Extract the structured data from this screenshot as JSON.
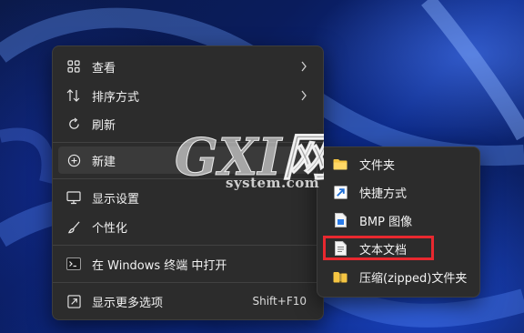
{
  "main_menu": {
    "items": [
      {
        "label": "查看",
        "icon": "grid-icon",
        "has_submenu": true
      },
      {
        "label": "排序方式",
        "icon": "sort-icon",
        "has_submenu": true
      },
      {
        "label": "刷新",
        "icon": "refresh-icon"
      },
      {
        "label": "新建",
        "icon": "plus-circle-icon",
        "has_submenu": true
      },
      {
        "label": "显示设置",
        "icon": "monitor-icon"
      },
      {
        "label": "个性化",
        "icon": "brush-icon"
      },
      {
        "label": "在 Windows 终端 中打开",
        "icon": "terminal-icon"
      },
      {
        "label": "显示更多选项",
        "icon": "more-options-icon",
        "shortcut": "Shift+F10"
      }
    ]
  },
  "sub_menu": {
    "items": [
      {
        "label": "文件夹",
        "icon": "folder-icon"
      },
      {
        "label": "快捷方式",
        "icon": "shortcut-icon"
      },
      {
        "label": "BMP 图像",
        "icon": "bmp-image-icon"
      },
      {
        "label": "文本文档",
        "icon": "text-document-icon",
        "highlighted": true
      },
      {
        "label": "压缩(zipped)文件夹",
        "icon": "zip-folder-icon"
      }
    ]
  },
  "watermark": {
    "text": "system.com"
  },
  "colors": {
    "menu_bg": "#2c2c2c",
    "highlight_border": "#e8282f",
    "folder_yellow": "#f5c542",
    "accent_blue": "#4aa8ff"
  }
}
